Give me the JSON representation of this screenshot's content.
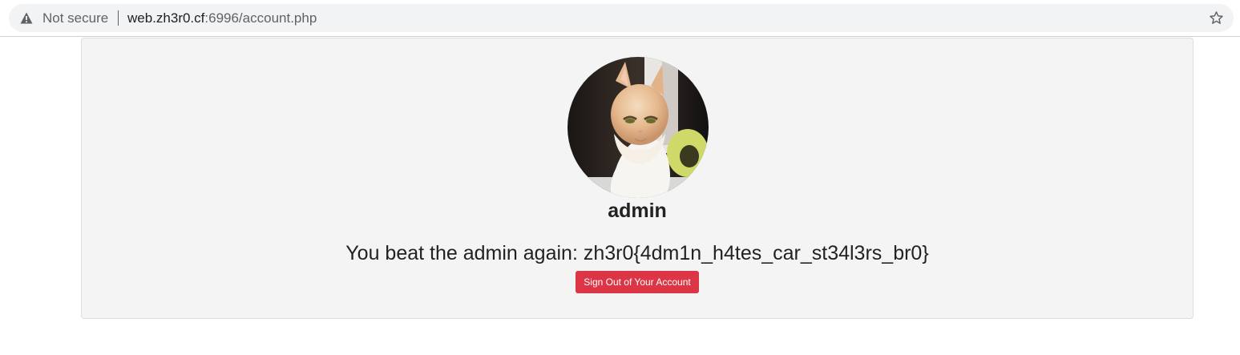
{
  "browser": {
    "security_label": "Not secure",
    "url_host": "web.zh3r0.cf",
    "url_rest": ":6996/account.php",
    "icons": [
      "warning-triangle-icon",
      "bookmark-star-icon"
    ]
  },
  "profile": {
    "avatar": "cat-photo",
    "username": "admin",
    "message": "You beat the admin again: zh3r0{4dm1n_h4tes_car_st34l3rs_br0}",
    "signout_label": "Sign Out of Your Account",
    "colors": {
      "card_bg": "#f4f4f4",
      "signout_bg": "#dc3545",
      "signout_text": "#ffffff"
    }
  }
}
